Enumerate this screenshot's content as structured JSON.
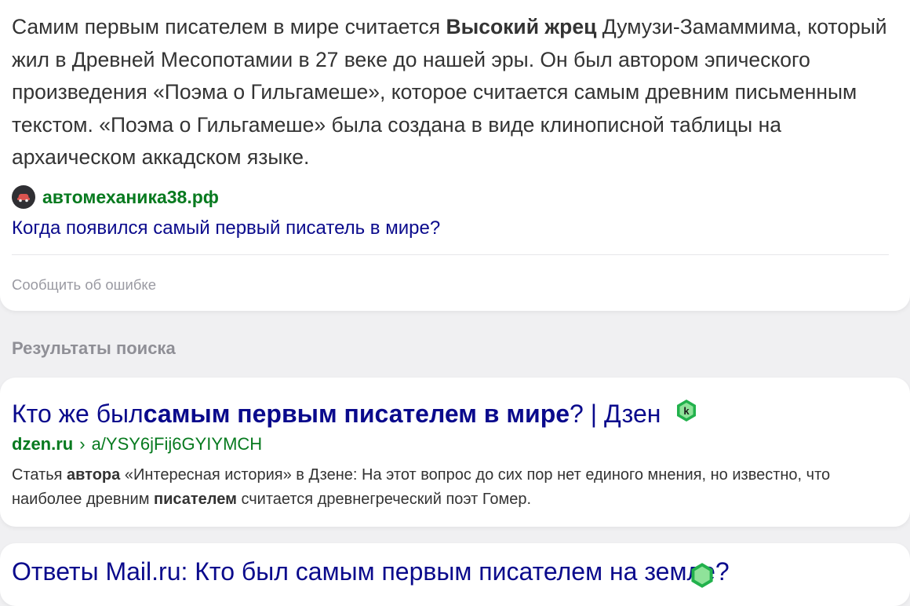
{
  "snippet": {
    "text_before": "Самим первым писателем в мире считается ",
    "text_bold": "Высокий жрец",
    "text_after": " Думузи-Замаммима, который жил в Древней Месопотамии в 27 веке до нашей эры. Он был автором эпического произведения «Поэма о Гильгамеше», которое считается самым древним письменным текстом. «Поэма о Гильгамеше» была создана в виде клинописной таблицы на архаическом аккадском языке.",
    "source_site": "автомеханика38.рф",
    "source_favicon": "car-icon",
    "source_link": "Когда появился самый первый писатель в мире?",
    "report_label": "Сообщить об ошибке"
  },
  "results_section_title": "Результаты поиска",
  "results": [
    {
      "title_part1": "Кто же был ",
      "title_bold": "самым первым писателем в мире",
      "title_part2": "? | Дзен",
      "badge_icon": "k-badge-icon",
      "domain": "dzen.ru",
      "separator": "›",
      "path": "a/YSY6jFij6GYIYMCH",
      "desc_1": "Статья ",
      "desc_bold1": "автора",
      "desc_2": " «Интересная история» в Дзене: На этот вопрос до сих пор нет единого мнения, но известно, что наиболее древним ",
      "desc_bold2": "писателем",
      "desc_3": " считается древнегреческий поэт Гомер."
    },
    {
      "title_partial": "Ответы Mail.ru: Кто был самым первым писателем на земле?"
    }
  ],
  "colors": {
    "link": "#0a0a8c",
    "site_green": "#077a1f",
    "text": "#333333",
    "muted": "#9a9aa2",
    "badge_green": "#22b14c"
  }
}
